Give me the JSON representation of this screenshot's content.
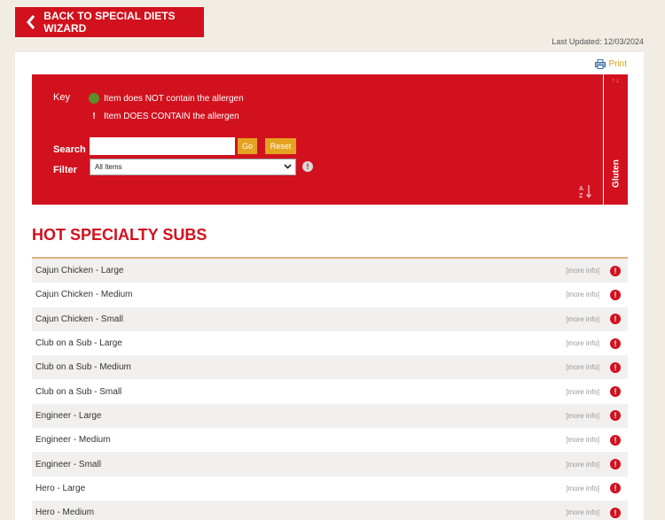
{
  "header": {
    "back_label": "BACK TO SPECIAL DIETS WIZARD",
    "last_updated": "Last Updated: 12/03/2024"
  },
  "toolbar": {
    "print_label": "Print"
  },
  "key": {
    "label": "Key",
    "no_allergen": "Item does NOT contain the allergen",
    "contains_allergen": "Item DOES CONTAIN the allergen",
    "contains_symbol": "!"
  },
  "search": {
    "label": "Search",
    "value": "",
    "placeholder": "",
    "go_label": "Go",
    "reset_label": "Reset"
  },
  "filter": {
    "label": "Filter",
    "selected": "All Items",
    "info_symbol": "!"
  },
  "columns": {
    "allergen": "Gluten",
    "sort_arrows": "↑↓"
  },
  "section": {
    "title": "HOT SPECIALTY SUBS"
  },
  "items": [
    {
      "name": "Cajun Chicken - Large",
      "more": "[more info]",
      "status": "!"
    },
    {
      "name": "Cajun Chicken - Medium",
      "more": "[more info]",
      "status": "!"
    },
    {
      "name": "Cajun Chicken - Small",
      "more": "[more info]",
      "status": "!"
    },
    {
      "name": "Club on a Sub - Large",
      "more": "[more info]",
      "status": "!"
    },
    {
      "name": "Club on a Sub - Medium",
      "more": "[more info]",
      "status": "!"
    },
    {
      "name": "Club on a Sub - Small",
      "more": "[more info]",
      "status": "!"
    },
    {
      "name": "Engineer - Large",
      "more": "[more info]",
      "status": "!"
    },
    {
      "name": "Engineer - Medium",
      "more": "[more info]",
      "status": "!"
    },
    {
      "name": "Engineer - Small",
      "more": "[more info]",
      "status": "!"
    },
    {
      "name": "Hero - Large",
      "more": "[more info]",
      "status": "!"
    },
    {
      "name": "Hero - Medium",
      "more": "[more info]",
      "status": "!"
    }
  ],
  "colors": {
    "brand_red": "#d2111e",
    "accent_yellow": "#e5a221",
    "safe_green": "#5a8e2a"
  },
  "icons": {
    "back": "chevron-left-icon",
    "print": "printer-icon",
    "sort": "sort-az-icon",
    "alert": "alert-icon"
  }
}
